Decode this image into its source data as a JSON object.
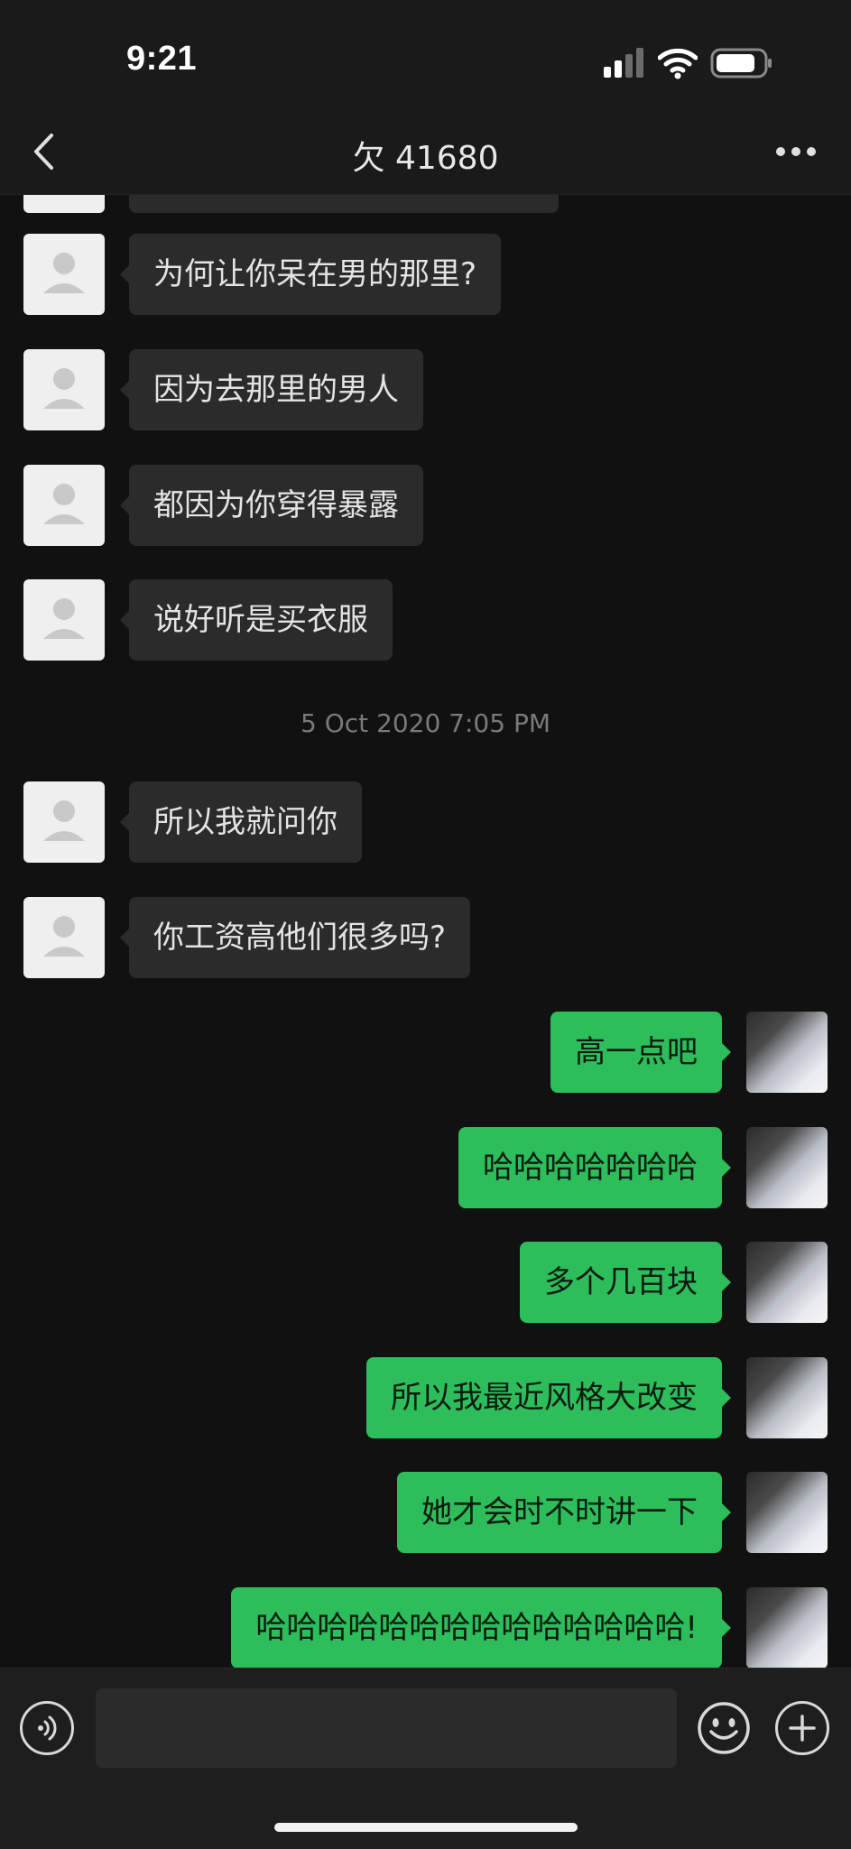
{
  "status_bar": {
    "time": "9:21"
  },
  "nav": {
    "title": "欠 41680"
  },
  "messages_before": [
    {
      "side": "in",
      "text": "为何让你呆在男的那里?"
    },
    {
      "side": "in",
      "text": "因为去那里的男人"
    },
    {
      "side": "in",
      "text": "都因为你穿得暴露"
    },
    {
      "side": "in",
      "text": "说好听是买衣服"
    }
  ],
  "timestamp": "5 Oct 2020 7:05 PM",
  "messages_after": [
    {
      "side": "in",
      "text": "所以我就问你"
    },
    {
      "side": "in",
      "text": "你工资高他们很多吗?"
    },
    {
      "side": "out",
      "text": "高一点吧"
    },
    {
      "side": "out",
      "text": "哈哈哈哈哈哈哈"
    },
    {
      "side": "out",
      "text": "多个几百块"
    },
    {
      "side": "out",
      "text": "所以我最近风格大改变"
    },
    {
      "side": "out",
      "text": "她才会时不时讲一下"
    },
    {
      "side": "out",
      "text": "哈哈哈哈哈哈哈哈哈哈哈哈哈哈!"
    }
  ],
  "input": {
    "value": "",
    "placeholder": ""
  },
  "colors": {
    "background": "#111111",
    "incoming_bubble": "#2b2b2b",
    "outgoing_bubble": "#2dbd5b",
    "header": "#1a1a1a"
  },
  "icons": {
    "back": "chevron-left-icon",
    "more": "more-dots-icon",
    "voice": "voice-icon",
    "emoji": "emoji-icon",
    "plus": "plus-icon"
  }
}
